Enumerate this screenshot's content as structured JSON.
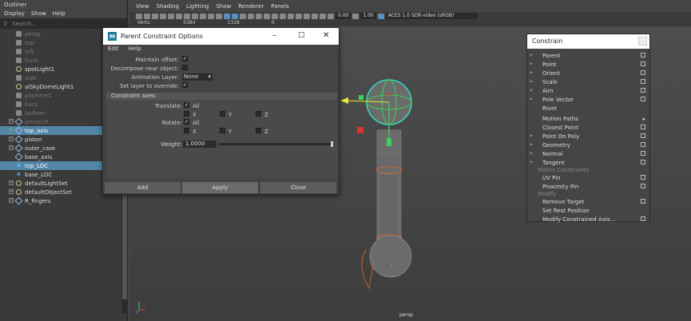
{
  "outliner": {
    "title": "Outliner",
    "menu": [
      "Display",
      "Show",
      "Help"
    ],
    "search_placeholder": "Search...",
    "items": [
      {
        "label": "persp",
        "icon": "camera-icon",
        "style": "dim"
      },
      {
        "label": "top",
        "icon": "camera-icon",
        "style": "dim"
      },
      {
        "label": "left",
        "icon": "camera-icon",
        "style": "dim"
      },
      {
        "label": "front",
        "icon": "camera-icon",
        "style": "dim"
      },
      {
        "label": "spotLight1",
        "icon": "light-icon",
        "style": "bright"
      },
      {
        "label": "side",
        "icon": "camera-icon",
        "style": "dim"
      },
      {
        "label": "aiSkyDomeLight1",
        "icon": "light-icon",
        "style": "bright"
      },
      {
        "label": "pSphere1",
        "icon": "mesh-icon",
        "style": "dim"
      },
      {
        "label": "back",
        "icon": "camera-icon",
        "style": "dim"
      },
      {
        "label": "bottom",
        "icon": "camera-icon",
        "style": "dim"
      },
      {
        "label": "group19",
        "icon": "group-icon",
        "style": "dim",
        "expand": true
      },
      {
        "label": "top_axis",
        "icon": "transform-icon",
        "style": "sel",
        "expand": true
      },
      {
        "label": "piston",
        "icon": "transform-icon",
        "style": "bright",
        "expand": true
      },
      {
        "label": "outer_case",
        "icon": "transform-icon",
        "style": "bright",
        "expand": true
      },
      {
        "label": "base_axis",
        "icon": "transform-icon",
        "style": "bright"
      },
      {
        "label": "top_LOC",
        "icon": "locator-icon",
        "style": "sel"
      },
      {
        "label": "base_LOC",
        "icon": "locator-icon",
        "style": "bright"
      },
      {
        "label": "defaultLightSet",
        "icon": "set-icon",
        "style": "bright",
        "expand": true
      },
      {
        "label": "defaultObjectSet",
        "icon": "set-icon",
        "style": "bright",
        "expand": true
      },
      {
        "label": "R_fingers",
        "icon": "transform-icon",
        "style": "bright",
        "expand": true
      }
    ]
  },
  "viewport": {
    "menu": [
      "View",
      "Shading",
      "Lighting",
      "Show",
      "Renderer",
      "Panels"
    ],
    "stats": {
      "label": "Verts:",
      "v1": "5384",
      "v2": "1328",
      "v3": "0"
    },
    "exposure": "0.00",
    "gamma": "1.00",
    "colorspace": "ACES 1.0 SDR-video (sRGB)",
    "camera": "persp"
  },
  "dialog": {
    "title": "Parent Constraint Options",
    "menu": [
      "Edit",
      "Help"
    ],
    "maintain_offset": "Maintain offset:",
    "decompose": "Decompose near object:",
    "anim_layer": "Animation Layer:",
    "anim_layer_value": "None",
    "set_layer": "Set layer to override:",
    "section": "Constraint axes:",
    "translate": "Translate:",
    "rotate": "Rotate:",
    "all": "All",
    "x": "X",
    "y": "Y",
    "z": "Z",
    "weight": "Weight:",
    "weight_value": "1.0000",
    "add": "Add",
    "apply": "Apply",
    "close": "Close"
  },
  "constrain": {
    "title": "Constrain",
    "items": [
      {
        "label": "Parent",
        "box": true,
        "icon": true
      },
      {
        "label": "Point",
        "box": true,
        "icon": true
      },
      {
        "label": "Orient",
        "box": true,
        "icon": true
      },
      {
        "label": "Scale",
        "box": true,
        "icon": true
      },
      {
        "label": "Aim",
        "box": true,
        "icon": true
      },
      {
        "label": "Pole Vector",
        "box": true,
        "icon": true
      },
      {
        "label": "Rivet",
        "box": false,
        "icon": false
      },
      {
        "label": "Motion Paths",
        "arrow": true,
        "icon": false
      },
      {
        "label": "Closest Point",
        "box": true,
        "icon": false
      },
      {
        "label": "Point On Poly",
        "box": true,
        "icon": true
      },
      {
        "label": "Geometry",
        "box": true,
        "icon": true
      },
      {
        "label": "Normal",
        "box": true,
        "icon": true
      },
      {
        "label": "Tangent",
        "box": true,
        "icon": true
      },
      {
        "label": "UV Pin",
        "box": true,
        "icon": false
      },
      {
        "label": "Proximity Pin",
        "box": true,
        "icon": false
      },
      {
        "label": "Remove Target",
        "box": true,
        "icon": false
      },
      {
        "label": "Set Rest Position",
        "box": false,
        "icon": false
      },
      {
        "label": "Modify Constrained Axis...",
        "box": true,
        "icon": false
      }
    ],
    "sep_matrix": "Matrix Constraints",
    "sep_modify": "Modify"
  }
}
